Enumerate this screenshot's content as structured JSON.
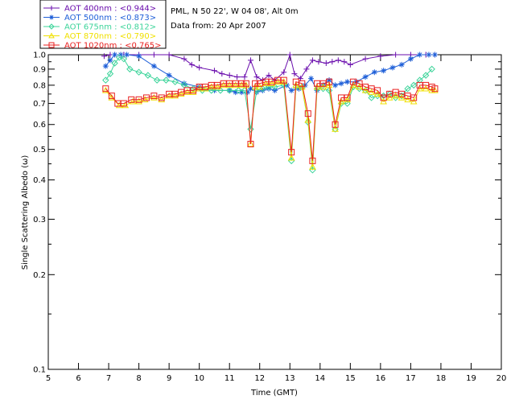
{
  "chart_data": {
    "type": "scatter",
    "xlabel": "Time (GMT)",
    "ylabel": "Single Scattering Albedo (ω)",
    "xlim": [
      5,
      20
    ],
    "ylim": [
      0.1,
      1.0
    ],
    "yscale": "log",
    "xticks": [
      "5",
      "6",
      "7",
      "8",
      "9",
      "10",
      "11",
      "12",
      "13",
      "14",
      "15",
      "16",
      "17",
      "18",
      "19",
      "20"
    ],
    "yticks": [
      {
        "value": 1.0,
        "label": "1.0"
      },
      {
        "value": 0.9,
        "label": "0.9"
      },
      {
        "value": 0.8,
        "label": "0.8"
      },
      {
        "value": 0.7,
        "label": "0.7"
      },
      {
        "value": 0.6,
        "label": "0.6"
      },
      {
        "value": 0.5,
        "label": "0.5"
      },
      {
        "value": 0.4,
        "label": "0.4"
      },
      {
        "value": 0.3,
        "label": "0.3"
      },
      {
        "value": 0.2,
        "label": "0.2"
      },
      {
        "value": 0.1,
        "label": "0.1"
      }
    ],
    "info_lines": [
      "PML, N 50 22', W 04 08', Alt 0m",
      "Data from: 20 Apr 2007"
    ],
    "grid": false,
    "legend_position": "top-left",
    "series": [
      {
        "name": "AOT  400nm : <0.944>",
        "color": "#6a0dad",
        "marker": "plus",
        "x": [
          6.85,
          7.05,
          7.2,
          7.5,
          8.0,
          8.5,
          9.0,
          9.5,
          9.75,
          10.0,
          10.5,
          10.75,
          11.0,
          11.25,
          11.5,
          11.7,
          11.9,
          12.1,
          12.3,
          12.5,
          12.8,
          13.0,
          13.15,
          13.35,
          13.55,
          13.75,
          13.95,
          14.2,
          14.4,
          14.6,
          14.8,
          15.0,
          15.5,
          16.0,
          16.5,
          17.0,
          17.5,
          17.8
        ],
        "y": [
          0.99,
          1.0,
          1.0,
          1.0,
          1.0,
          1.0,
          1.0,
          0.97,
          0.93,
          0.91,
          0.89,
          0.87,
          0.86,
          0.85,
          0.85,
          0.96,
          0.85,
          0.83,
          0.86,
          0.83,
          0.88,
          1.0,
          0.87,
          0.84,
          0.9,
          0.96,
          0.95,
          0.94,
          0.95,
          0.96,
          0.95,
          0.93,
          0.97,
          0.99,
          1.0,
          1.0,
          1.0,
          1.0
        ]
      },
      {
        "name": "AOT  500nm : <0.873>",
        "color": "#1e5fd8",
        "marker": "star",
        "x": [
          6.9,
          7.05,
          7.2,
          7.4,
          7.6,
          8.0,
          8.5,
          9.0,
          9.5,
          10.0,
          10.5,
          11.0,
          11.2,
          11.4,
          11.6,
          11.7,
          11.9,
          12.1,
          12.3,
          12.5,
          12.9,
          13.05,
          13.3,
          13.5,
          13.7,
          13.9,
          14.1,
          14.3,
          14.5,
          14.7,
          14.9,
          15.2,
          15.5,
          15.8,
          16.1,
          16.4,
          16.7,
          17.0,
          17.3,
          17.6,
          17.8
        ],
        "y": [
          0.92,
          0.96,
          1.0,
          1.0,
          1.0,
          0.99,
          0.92,
          0.86,
          0.81,
          0.79,
          0.77,
          0.77,
          0.76,
          0.76,
          0.76,
          0.78,
          0.76,
          0.77,
          0.78,
          0.77,
          0.8,
          0.77,
          0.78,
          0.8,
          0.84,
          0.77,
          0.8,
          0.83,
          0.8,
          0.81,
          0.82,
          0.82,
          0.85,
          0.88,
          0.89,
          0.91,
          0.93,
          0.97,
          1.0,
          1.0,
          1.0
        ]
      },
      {
        "name": "AOT  675nm : <0.812>",
        "color": "#3cd49a",
        "marker": "diamond",
        "x": [
          6.9,
          7.05,
          7.2,
          7.35,
          7.5,
          7.7,
          8.0,
          8.3,
          8.6,
          8.9,
          9.2,
          9.5,
          9.8,
          10.1,
          10.4,
          10.7,
          11.0,
          11.3,
          11.5,
          11.7,
          11.9,
          12.1,
          12.3,
          12.5,
          12.8,
          13.05,
          13.2,
          13.4,
          13.6,
          13.75,
          13.9,
          14.1,
          14.3,
          14.5,
          14.7,
          14.9,
          15.1,
          15.3,
          15.5,
          15.7,
          15.9,
          16.1,
          16.3,
          16.5,
          16.7,
          16.9,
          17.1,
          17.3,
          17.5,
          17.7
        ],
        "y": [
          0.83,
          0.87,
          0.94,
          0.98,
          0.97,
          0.9,
          0.88,
          0.86,
          0.83,
          0.83,
          0.82,
          0.8,
          0.78,
          0.77,
          0.77,
          0.77,
          0.77,
          0.77,
          0.77,
          0.58,
          0.77,
          0.78,
          0.79,
          0.79,
          0.8,
          0.46,
          0.79,
          0.79,
          0.61,
          0.43,
          0.78,
          0.78,
          0.77,
          0.58,
          0.7,
          0.7,
          0.79,
          0.78,
          0.77,
          0.73,
          0.74,
          0.74,
          0.75,
          0.73,
          0.74,
          0.78,
          0.8,
          0.83,
          0.86,
          0.9
        ]
      },
      {
        "name": "AOT  870nm : <0.790>",
        "color": "#f0e000",
        "marker": "triangle",
        "x": [
          6.9,
          7.1,
          7.35,
          7.55,
          7.8,
          8.0,
          8.2,
          8.5,
          8.75,
          9.0,
          9.2,
          9.4,
          9.6,
          9.8,
          10.0,
          10.2,
          10.4,
          10.6,
          10.8,
          11.0,
          11.2,
          11.4,
          11.55,
          11.7,
          11.85,
          12.0,
          12.2,
          12.4,
          12.6,
          12.8,
          13.05,
          13.2,
          13.4,
          13.6,
          13.75,
          13.9,
          14.1,
          14.3,
          14.5,
          14.7,
          14.9,
          15.1,
          15.3,
          15.5,
          15.7,
          15.9,
          16.1,
          16.3,
          16.5,
          16.7,
          16.9,
          17.1,
          17.3,
          17.5,
          17.7,
          17.8
        ],
        "y": [
          0.77,
          0.73,
          0.69,
          0.69,
          0.71,
          0.71,
          0.72,
          0.73,
          0.72,
          0.74,
          0.74,
          0.75,
          0.76,
          0.76,
          0.78,
          0.78,
          0.79,
          0.79,
          0.8,
          0.8,
          0.8,
          0.8,
          0.8,
          0.52,
          0.79,
          0.79,
          0.81,
          0.81,
          0.82,
          0.82,
          0.47,
          0.8,
          0.79,
          0.62,
          0.44,
          0.79,
          0.79,
          0.8,
          0.58,
          0.71,
          0.72,
          0.8,
          0.79,
          0.77,
          0.76,
          0.75,
          0.71,
          0.73,
          0.74,
          0.73,
          0.72,
          0.71,
          0.78,
          0.78,
          0.77,
          0.77
        ]
      },
      {
        "name": "AOT 1020nm : <0.765>",
        "color": "#e82020",
        "marker": "square",
        "x": [
          6.9,
          7.1,
          7.3,
          7.5,
          7.75,
          8.0,
          8.25,
          8.5,
          8.75,
          9.0,
          9.2,
          9.4,
          9.6,
          9.8,
          10.0,
          10.2,
          10.4,
          10.6,
          10.8,
          11.0,
          11.2,
          11.4,
          11.55,
          11.7,
          11.85,
          12.0,
          12.2,
          12.4,
          12.6,
          12.8,
          13.05,
          13.2,
          13.4,
          13.6,
          13.75,
          13.9,
          14.1,
          14.3,
          14.5,
          14.7,
          14.9,
          15.1,
          15.3,
          15.5,
          15.7,
          15.9,
          16.1,
          16.3,
          16.5,
          16.7,
          16.9,
          17.1,
          17.3,
          17.5,
          17.7,
          17.8
        ],
        "y": [
          0.78,
          0.74,
          0.7,
          0.7,
          0.72,
          0.72,
          0.73,
          0.74,
          0.73,
          0.75,
          0.75,
          0.76,
          0.77,
          0.77,
          0.79,
          0.79,
          0.8,
          0.8,
          0.81,
          0.81,
          0.81,
          0.81,
          0.81,
          0.52,
          0.81,
          0.81,
          0.82,
          0.82,
          0.83,
          0.83,
          0.49,
          0.82,
          0.81,
          0.65,
          0.46,
          0.81,
          0.81,
          0.82,
          0.6,
          0.73,
          0.73,
          0.82,
          0.81,
          0.79,
          0.78,
          0.77,
          0.73,
          0.75,
          0.76,
          0.75,
          0.74,
          0.73,
          0.8,
          0.8,
          0.79,
          0.78
        ]
      }
    ]
  }
}
